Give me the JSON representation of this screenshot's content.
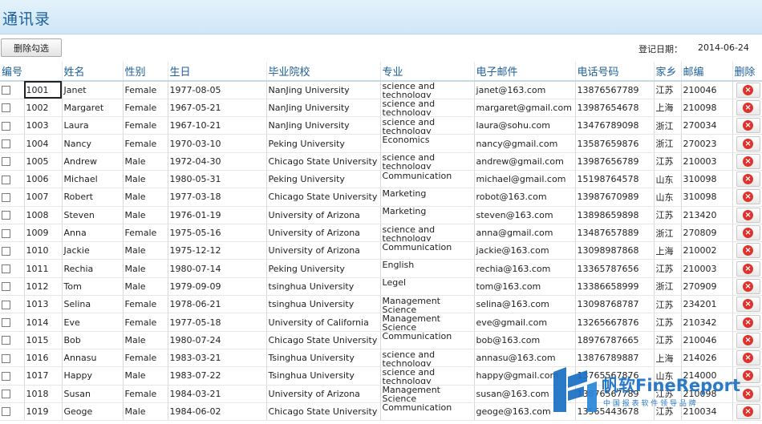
{
  "page": {
    "title": "通讯录",
    "delete_checked_label": "删除勾选",
    "reg_date_label": "登记日期：",
    "reg_date_value": "2014-06-24"
  },
  "table": {
    "headers": [
      "编号",
      "姓名",
      "性别",
      "生日",
      "毕业院校",
      "专业",
      "电子邮件",
      "电话号码",
      "家乡",
      "邮编",
      "删除"
    ],
    "rows": [
      {
        "id": "1001",
        "name": "Janet",
        "gender": "Female",
        "birthday": "1977-08-05",
        "school": "NanJing University",
        "major": "science and technology",
        "email": "janet@163.com",
        "phone": "13876567789",
        "hometown": "江苏",
        "zip": "210046"
      },
      {
        "id": "1002",
        "name": "Margaret",
        "gender": "Female",
        "birthday": "1967-05-21",
        "school": "NanJing University",
        "major": "science and technology",
        "email": "margaret@gmail.com",
        "phone": "13987654678",
        "hometown": "上海",
        "zip": "210098"
      },
      {
        "id": "1003",
        "name": "Laura",
        "gender": "Female",
        "birthday": "1967-10-21",
        "school": "NanJing University",
        "major": "science and technology",
        "email": "laura@sohu.com",
        "phone": "13476789098",
        "hometown": "浙江",
        "zip": "270034"
      },
      {
        "id": "1004",
        "name": "Nancy",
        "gender": "Female",
        "birthday": "1970-03-10",
        "school": "Peking University",
        "major": "Economics",
        "email": "nancy@gmail.com",
        "phone": "13587659876",
        "hometown": "浙江",
        "zip": "270023"
      },
      {
        "id": "1005",
        "name": "Andrew",
        "gender": "Male",
        "birthday": "1972-04-30",
        "school": "Chicago State University",
        "major": "science and technology",
        "email": "andrew@gmail.com",
        "phone": "13987656789",
        "hometown": "江苏",
        "zip": "210003"
      },
      {
        "id": "1006",
        "name": "Michael",
        "gender": "Male",
        "birthday": "1980-05-31",
        "school": "Peking University",
        "major": "Communication",
        "email": "michael@gmail.com",
        "phone": "15198764578",
        "hometown": "山东",
        "zip": "310098"
      },
      {
        "id": "1007",
        "name": "Robert",
        "gender": "Male",
        "birthday": "1977-03-18",
        "school": "Chicago State University",
        "major": "Marketing",
        "email": "robot@163.com",
        "phone": "13987670989",
        "hometown": "山东",
        "zip": "310098"
      },
      {
        "id": "1008",
        "name": "Steven",
        "gender": "Male",
        "birthday": "1976-01-19",
        "school": "University of Arizona",
        "major": "Marketing",
        "email": "steven@163.com",
        "phone": "13898659898",
        "hometown": "江苏",
        "zip": "213420"
      },
      {
        "id": "1009",
        "name": "Anna",
        "gender": "Female",
        "birthday": "1975-05-16",
        "school": "University of Arizona",
        "major": "science and technology",
        "email": "anna@gmail.com",
        "phone": "13487657889",
        "hometown": "浙江",
        "zip": "270809"
      },
      {
        "id": "1010",
        "name": "Jackie",
        "gender": "Male",
        "birthday": "1975-12-12",
        "school": "University of Arizona",
        "major": "Communication",
        "email": "jackie@163.com",
        "phone": "13098987868",
        "hometown": "上海",
        "zip": "210002"
      },
      {
        "id": "1011",
        "name": "Rechia",
        "gender": "Male",
        "birthday": "1980-07-14",
        "school": "Peking University",
        "major": "English",
        "email": "rechia@163.com",
        "phone": "13365787656",
        "hometown": "江苏",
        "zip": "210003"
      },
      {
        "id": "1012",
        "name": "Tom",
        "gender": "Male",
        "birthday": "1979-09-09",
        "school": "tsinghua University",
        "major": "Legel",
        "email": "tom@163.com",
        "phone": "13386658999",
        "hometown": "浙江",
        "zip": "270909"
      },
      {
        "id": "1013",
        "name": "Selina",
        "gender": "Female",
        "birthday": "1978-06-21",
        "school": "tsinghua University",
        "major": "Management Science",
        "email": "selina@163.com",
        "phone": "13098768787",
        "hometown": "江苏",
        "zip": "234201"
      },
      {
        "id": "1014",
        "name": "Eve",
        "gender": "Female",
        "birthday": "1977-05-18",
        "school": "University of California",
        "major": "Management Science",
        "email": "eve@gmail.com",
        "phone": "13265667876",
        "hometown": "江苏",
        "zip": "210342"
      },
      {
        "id": "1015",
        "name": "Bob",
        "gender": "Male",
        "birthday": "1980-07-24",
        "school": "Chicago State University",
        "major": "Communication",
        "email": "bob@163.com",
        "phone": "18976787665",
        "hometown": "江苏",
        "zip": "210046"
      },
      {
        "id": "1016",
        "name": "Annasu",
        "gender": "Female",
        "birthday": "1983-03-21",
        "school": "Tsinghua University",
        "major": "science and technology",
        "email": "annasu@163.com",
        "phone": "13876789887",
        "hometown": "上海",
        "zip": "214026"
      },
      {
        "id": "1017",
        "name": "Happy",
        "gender": "Male",
        "birthday": "1983-07-22",
        "school": "Tsinghua University",
        "major": "science and technology",
        "email": "happy@gmail.com",
        "phone": "13765567876",
        "hometown": "山东",
        "zip": "214000"
      },
      {
        "id": "1018",
        "name": "Susan",
        "gender": "Female",
        "birthday": "1984-03-21",
        "school": "University of Arizona",
        "major": "Management Science",
        "email": "susan@163.com",
        "phone": "13876567789",
        "hometown": "江苏",
        "zip": "210098"
      },
      {
        "id": "1019",
        "name": "Geoge",
        "gender": "Male",
        "birthday": "1984-06-02",
        "school": "Chicago State University",
        "major": "Communication",
        "email": "geoge@163.com",
        "phone": "13565443678",
        "hometown": "江苏",
        "zip": "210034"
      }
    ]
  },
  "watermark": {
    "brand": "帆软FineReport",
    "tagline": "中 国 报 表 软 件 领 导 品 牌"
  },
  "colors": {
    "accent": "#1c5f9a",
    "title_bar": "#d6ebf8",
    "delete_red": "#e0312b",
    "brand_blue": "#1a6fc4"
  }
}
